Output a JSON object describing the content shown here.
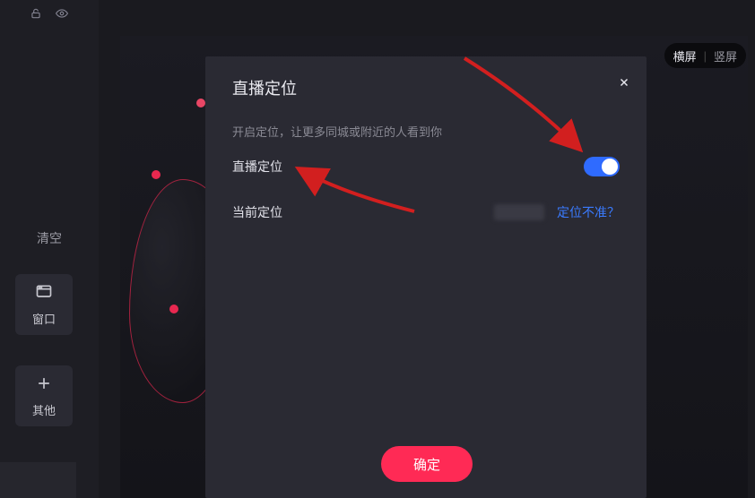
{
  "sidebar": {
    "clear_label": "清空",
    "window_label": "窗口",
    "other_label": "其他"
  },
  "orientation": {
    "landscape": "横屏",
    "portrait": "竖屏"
  },
  "modal": {
    "title": "直播定位",
    "subtext": "开启定位，让更多同城或附近的人看到你",
    "row_location_label": "直播定位",
    "row_current_label": "当前定位",
    "inaccurate_link": "定位不准？",
    "confirm": "确定",
    "toggle_state": "on"
  },
  "colors": {
    "accent_pink": "#ff2a55",
    "accent_blue": "#2f6bff",
    "link_blue": "#3a7bff",
    "arrow_red": "#d21f1f"
  }
}
